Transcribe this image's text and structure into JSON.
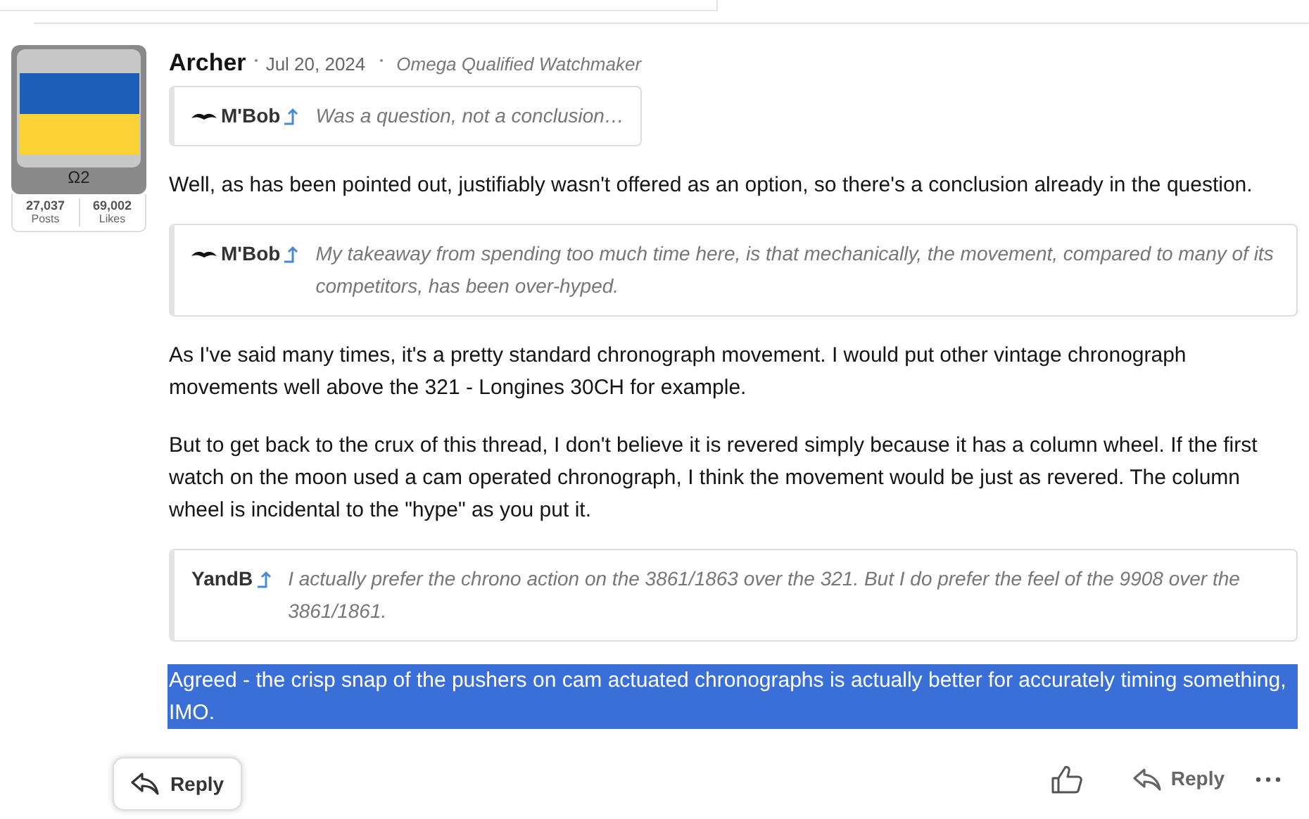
{
  "author": {
    "name": "Archer",
    "date": "Jul 20, 2024",
    "title": "Omega Qualified Watchmaker",
    "badge": "Ω2",
    "stats": [
      {
        "value": "27,037",
        "label": "Posts"
      },
      {
        "value": "69,002",
        "label": "Likes"
      }
    ]
  },
  "blocks": [
    {
      "kind": "quote",
      "author": "M'Bob",
      "avatar": true,
      "text": "Was a question, not a conclusion…"
    },
    {
      "kind": "paragraph",
      "text": "Well, as has been pointed out, justifiably wasn't offered as an option, so there's a conclusion already in the question.",
      "highlighted": false
    },
    {
      "kind": "quote",
      "author": "M'Bob",
      "avatar": true,
      "text": "My takeaway from spending too much time here, is that mechanically, the movement, compared to many of its competitors, has been over-hyped."
    },
    {
      "kind": "paragraph",
      "text": "As I've said many times, it's a pretty standard chronograph movement. I would put other vintage chronograph movements well above the 321 - Longines 30CH for example.",
      "highlighted": false
    },
    {
      "kind": "paragraph",
      "text": "But to get back to the crux of this thread, I don't believe it is revered simply because it has a column wheel. If the first watch on the moon used a cam operated chronograph, I think the movement would be just as revered. The column wheel is incidental to the \"hype\" as you put it.",
      "highlighted": false
    },
    {
      "kind": "quote",
      "author": "YandB",
      "avatar": false,
      "text": "I actually prefer the chrono action on the 3861/1863 over the 321. But I do prefer the feel of the 9908 over the 3861/1861."
    },
    {
      "kind": "paragraph",
      "text": "Agreed - the crisp snap of the pushers on cam actuated chronographs is actually better for accurately timing something, IMO.",
      "highlighted": true
    }
  ],
  "actions": {
    "reply": "Reply"
  },
  "floating_reply": "Reply"
}
